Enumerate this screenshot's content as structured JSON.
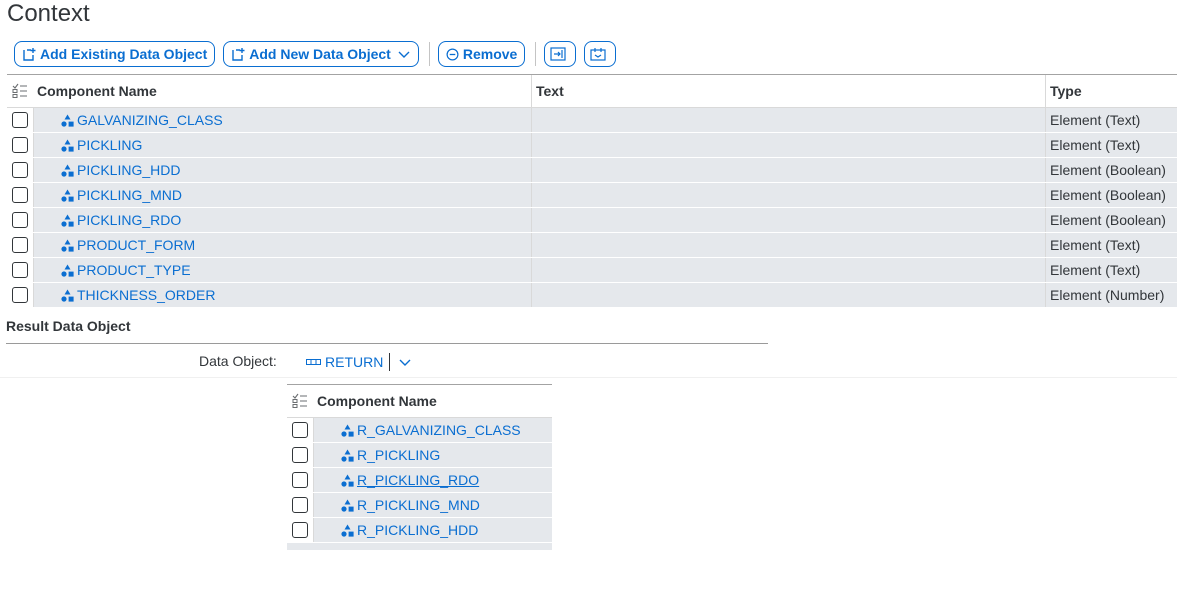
{
  "page": {
    "title": "Context"
  },
  "toolbar": {
    "add_existing_label": "Add Existing Data Object",
    "add_new_label": "Add New Data Object",
    "remove_label": "Remove"
  },
  "context_table": {
    "headers": {
      "name": "Component Name",
      "text": "Text",
      "type": "Type"
    },
    "rows": [
      {
        "name": "GALVANIZING_CLASS",
        "text": "",
        "type": "Element (Text)"
      },
      {
        "name": "PICKLING",
        "text": "",
        "type": "Element (Text)"
      },
      {
        "name": "PICKLING_HDD",
        "text": "",
        "type": "Element (Boolean)"
      },
      {
        "name": "PICKLING_MND",
        "text": "",
        "type": "Element (Boolean)"
      },
      {
        "name": "PICKLING_RDO",
        "text": "",
        "type": "Element (Boolean)"
      },
      {
        "name": "PRODUCT_FORM",
        "text": "",
        "type": "Element (Text)"
      },
      {
        "name": "PRODUCT_TYPE",
        "text": "",
        "type": "Element (Text)"
      },
      {
        "name": "THICKNESS_ORDER",
        "text": "",
        "type": "Element (Number)"
      }
    ]
  },
  "result": {
    "title": "Result Data Object",
    "data_object_label": "Data Object:",
    "data_object_value": "RETURN",
    "table": {
      "header": "Component Name",
      "rows": [
        {
          "name": "R_GALVANIZING_CLASS"
        },
        {
          "name": "R_PICKLING"
        },
        {
          "name": "R_PICKLING_RDO"
        },
        {
          "name": "R_PICKLING_MND"
        },
        {
          "name": "R_PICKLING_HDD"
        }
      ]
    }
  },
  "colors": {
    "accent": "#0a6ed1",
    "row_bg": "#e5e8ec",
    "text": "#32363a"
  },
  "icons": [
    "add-existing-icon",
    "add-new-icon",
    "remove-icon",
    "expand-icon",
    "collapse-icon",
    "element-icon",
    "structure-icon",
    "chevron-down-icon",
    "select-all-icon"
  ]
}
